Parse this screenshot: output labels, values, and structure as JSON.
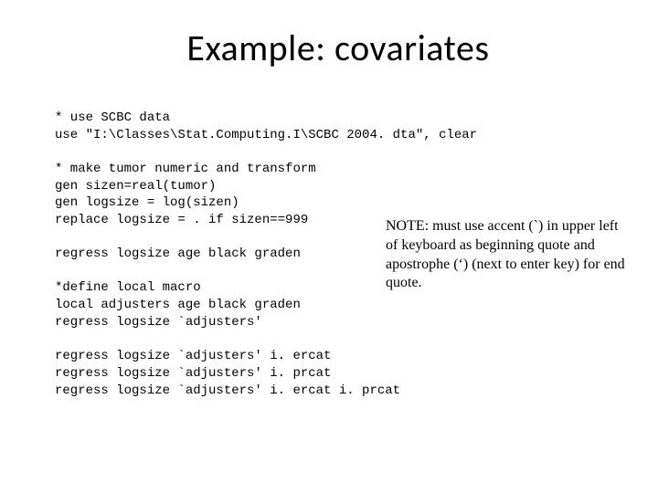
{
  "title": "Example: covariates",
  "code": {
    "b1l1": "* use SCBC data",
    "b1l2": "use \"I:\\Classes\\Stat.Computing.I\\SCBC 2004. dta\", clear",
    "b2l1": "* make tumor numeric and transform",
    "b2l2": "gen sizen=real(tumor)",
    "b2l3": "gen logsize = log(sizen)",
    "b2l4": "replace logsize = . if sizen==999",
    "b3l1": "regress logsize age black graden",
    "b4l1": "*define local macro",
    "b4l2": "local adjusters age black graden",
    "b4l3": "regress logsize `adjusters'",
    "b5l1": "regress logsize `adjusters' i. ercat",
    "b5l2": "regress logsize `adjusters' i. prcat",
    "b5l3": "regress logsize `adjusters' i. ercat i. prcat"
  },
  "note": "NOTE:  must use accent (`) in upper left of keyboard as beginning quote and apostrophe  (‘) (next to enter key) for end quote."
}
